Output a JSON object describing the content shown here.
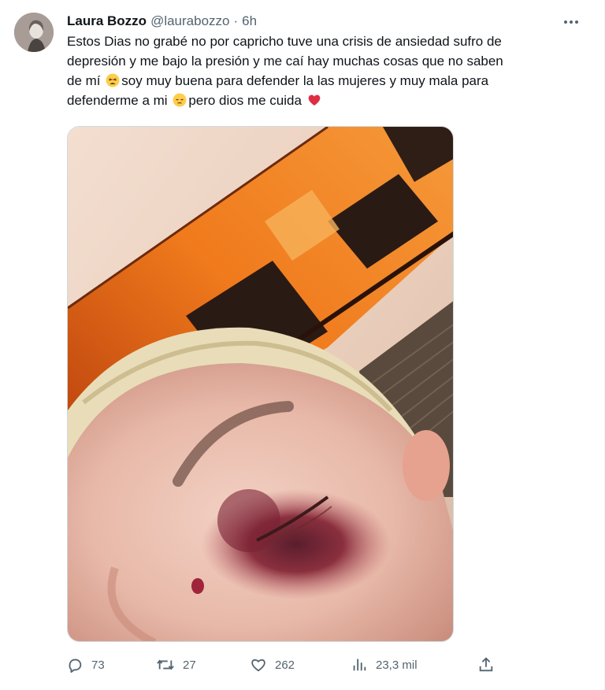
{
  "tweet": {
    "display_name": "Laura Bozzo",
    "handle": "@laurabozzo",
    "separator": "·",
    "time": "6h",
    "text_lines": [
      "Estos Dias no grabé no por capricho tuve una crisis de ansiedad sufro de",
      "depresión y me bajo la presión y me caí hay muchas cosas que no saben",
      "de mí",
      "soy muy buena para defender la las mujeres y muy mala para",
      "defenderme a mi",
      "pero dios me cuida"
    ],
    "emojis": [
      "tired-face-emoji",
      "pensive-face-emoji",
      "red-heart-emoji"
    ]
  },
  "actions": {
    "replies": "73",
    "retweets": "27",
    "likes": "262",
    "views": "23,3 mil"
  },
  "icons": {
    "more": "more-options-icon",
    "reply": "reply-icon",
    "retweet": "retweet-icon",
    "like": "heart-icon",
    "views": "views-icon",
    "share": "share-icon"
  },
  "colors": {
    "text": "#0f1419",
    "muted": "#536471",
    "border": "#cfd9de",
    "heart_emoji": "#dd2e44"
  }
}
